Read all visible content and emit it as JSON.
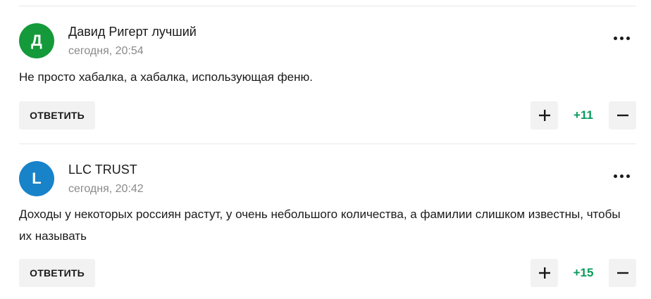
{
  "colors": {
    "avatar_green": "#149a3a",
    "avatar_blue": "#1883c9",
    "score_positive": "#0a9b5b"
  },
  "comments": [
    {
      "avatar_letter": "Д",
      "avatar_color": "#149a3a",
      "author": "Давид Ригерт лучший",
      "time": "сегодня, 20:54",
      "text": "Не просто хабалка, а хабалка, использующая феню.",
      "reply_label": "ОТВЕТИТЬ",
      "score": "+11",
      "more_icon": "more-horizontal-icon",
      "upvote_icon": "plus-icon",
      "downvote_icon": "minus-icon"
    },
    {
      "avatar_letter": "L",
      "avatar_color": "#1883c9",
      "author": "LLC TRUST",
      "time": "сегодня, 20:42",
      "text": "Доходы у некоторых россиян растут, у очень небольшого количества, а фамилии слишком известны, чтобы их называть",
      "reply_label": "ОТВЕТИТЬ",
      "score": "+15",
      "more_icon": "more-horizontal-icon",
      "upvote_icon": "plus-icon",
      "downvote_icon": "minus-icon"
    }
  ]
}
